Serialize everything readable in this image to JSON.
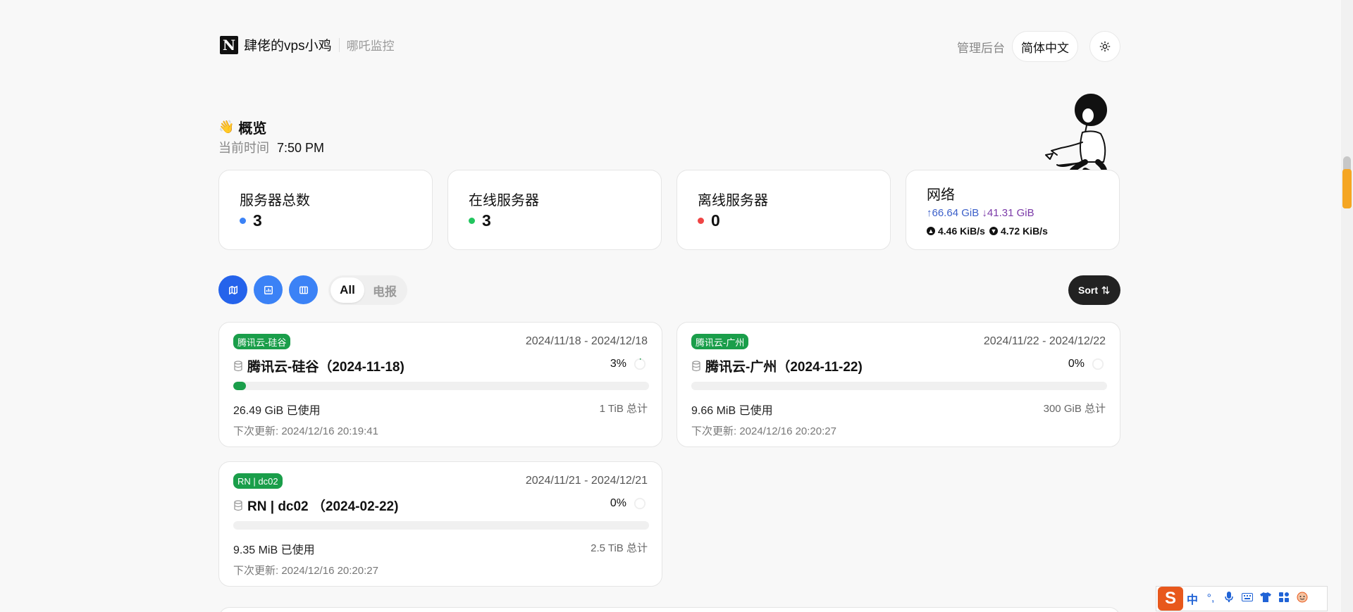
{
  "header": {
    "logo_letter": "N",
    "site_title": "肆佬的vps小鸡",
    "site_subtitle": "哪吒监控",
    "admin_link": "管理后台",
    "language": "简体中文",
    "theme_icon": "sun-icon"
  },
  "overview": {
    "title": "概览",
    "wave_emoji": "👋",
    "time_label": "当前时间",
    "time_value": "7:50 PM"
  },
  "stats": {
    "total": {
      "label": "服务器总数",
      "value": "3",
      "color": "#3b82f6"
    },
    "online": {
      "label": "在线服务器",
      "value": "3",
      "color": "#22c55e"
    },
    "offline": {
      "label": "离线服务器",
      "value": "0",
      "color": "#ef4444"
    },
    "network": {
      "label": "网络",
      "upload_total": "↑66.64 GiB",
      "download_total": "↓41.31 GiB",
      "upload_speed": "4.46 KiB/s",
      "download_speed": "4.72 KiB/s"
    }
  },
  "toolbar": {
    "view_buttons": [
      "map-icon",
      "chart-icon",
      "columns-icon"
    ],
    "tabs": [
      "All",
      "电报"
    ],
    "active_tab": "All",
    "sort_label": "Sort",
    "sort_icon": "sort-arrows-icon",
    "accent": "#2563eb"
  },
  "servers": [
    {
      "tag": "腾讯云-硅谷",
      "period": "2024/11/18 - 2024/12/18",
      "name": "腾讯云-硅谷（2024-11-18)",
      "percent_label": "3%",
      "usage_fraction": 0.03,
      "used": "26.49 GiB 已使用",
      "total": "1 TiB 总计",
      "next_update": "下次更新: 2024/12/16 20:19:41"
    },
    {
      "tag": "腾讯云-广州",
      "period": "2024/11/22 - 2024/12/22",
      "name": "腾讯云-广州（2024-11-22)",
      "percent_label": "0%",
      "usage_fraction": 0.0,
      "used": "9.66 MiB 已使用",
      "total": "300 GiB 总计",
      "next_update": "下次更新: 2024/12/16 20:20:27"
    },
    {
      "tag": "RN | dc02",
      "period": "2024/11/21 - 2024/12/21",
      "name": "RN | dc02 （2024-02-22)",
      "percent_label": "0%",
      "usage_fraction": 0.0,
      "used": "9.35 MiB 已使用",
      "total": "2.5 TiB 总计",
      "next_update": "下次更新: 2024/12/16 20:20:27"
    }
  ],
  "ime": {
    "logo": "S",
    "items": [
      "中",
      "°,",
      "mic-icon",
      "keyboard-icon",
      "shirt-icon",
      "grid-icon",
      "face-icon"
    ]
  }
}
